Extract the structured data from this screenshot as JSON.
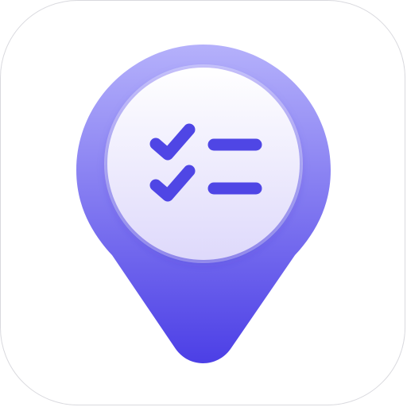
{
  "app_icon": {
    "tile_color": "#ffffff",
    "tile_border_color": "#d9d9de",
    "pin": {
      "icon": "map-pin-icon",
      "gradient_top": "#b5b1fb",
      "gradient_bottom": "#4c3fe6"
    },
    "badge": {
      "gradient_top": "#ffffff",
      "gradient_bottom": "#ded9fb",
      "ring_color": "#ffffff"
    },
    "checklist": {
      "icon": "checklist-icon",
      "color": "#4f46e5",
      "items": [
        {
          "checked": true
        },
        {
          "checked": true
        }
      ]
    }
  }
}
